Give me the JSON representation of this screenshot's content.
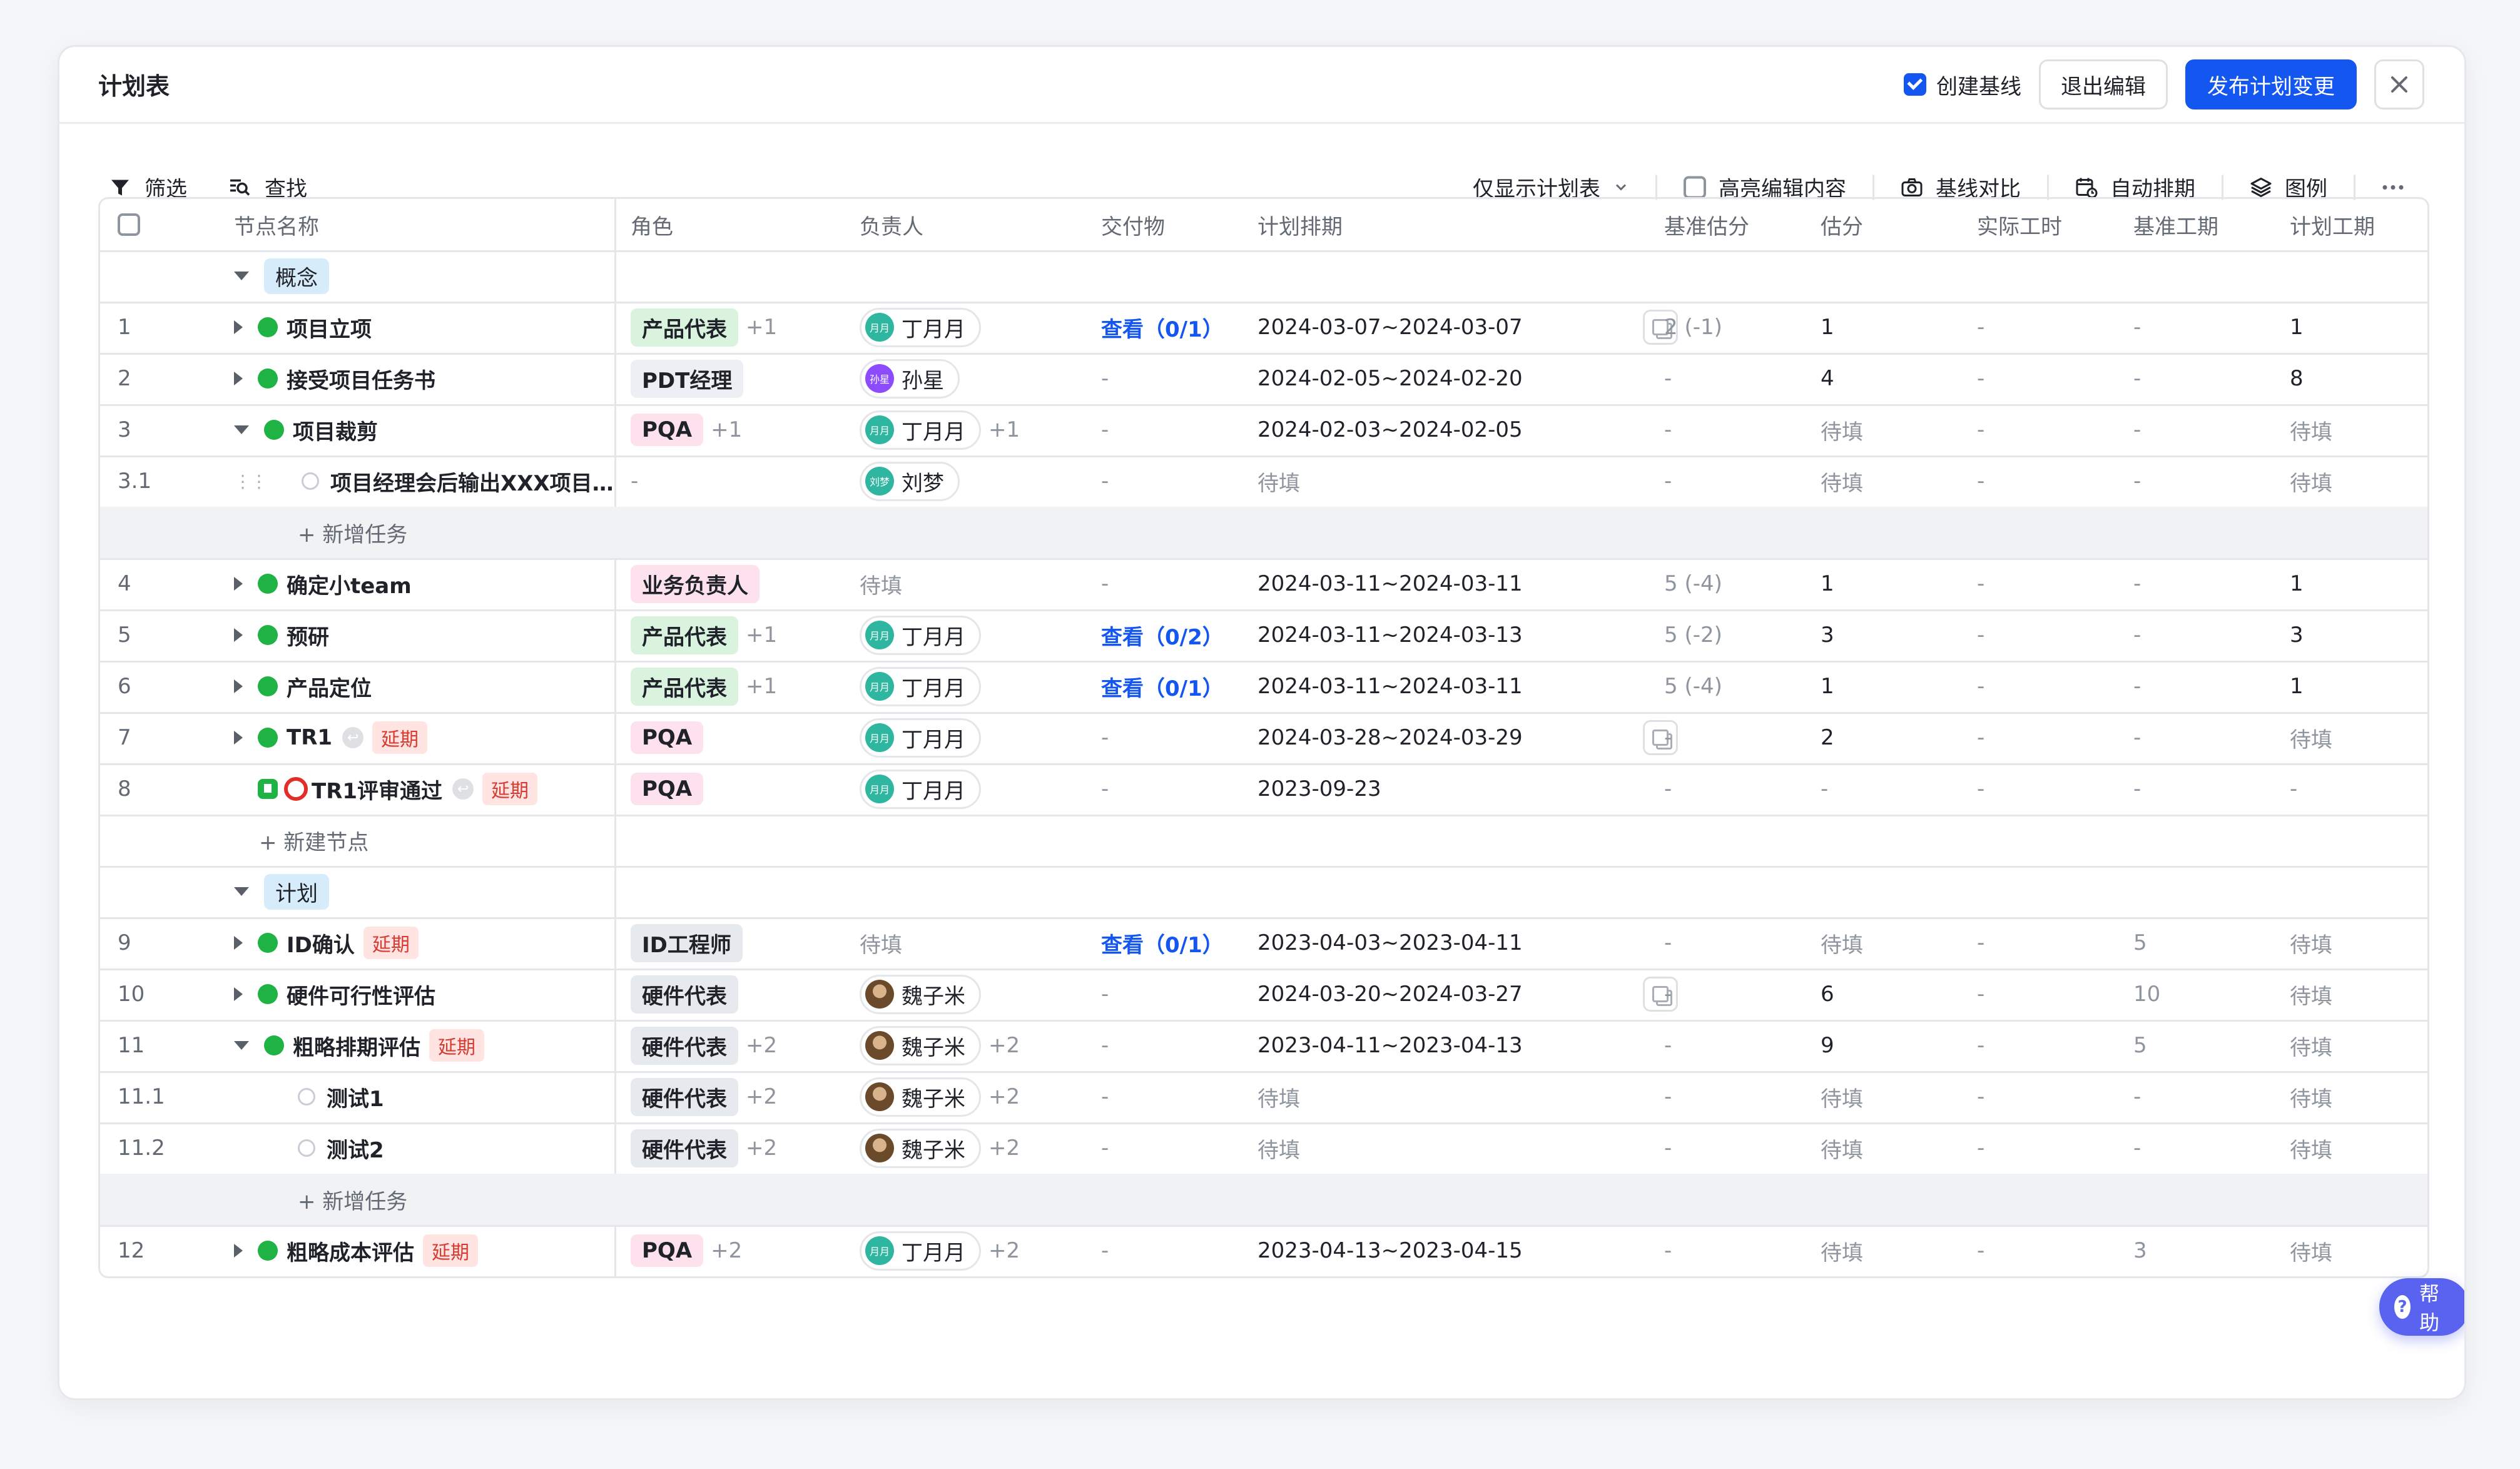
{
  "header": {
    "title": "计划表",
    "create_baseline_label": "创建基线",
    "create_baseline_checked": true,
    "exit_edit_label": "退出编辑",
    "publish_label": "发布计划变更",
    "close_icon": "close-icon"
  },
  "toolbar": {
    "filter_label": "筛选",
    "search_label": "查找",
    "view_select_value": "仅显示计划表",
    "highlight_label": "高亮编辑内容",
    "compare_label": "基线对比",
    "auto_schedule_label": "自动排期",
    "legend_label": "图例",
    "more_icon": "more-icon"
  },
  "columns": [
    "节点名称",
    "角色",
    "负责人",
    "交付物",
    "计划排期",
    "基准估分",
    "估分",
    "实际工时",
    "基准工期",
    "计划工期"
  ],
  "groups": {
    "concept": "概念",
    "plan": "计划"
  },
  "rows": [
    {
      "num": "1",
      "name": "项目立项",
      "role": "产品代表",
      "role_extra": "+1",
      "owner": "丁月月",
      "owner_avatar": "月月",
      "owner_extra": "",
      "deliverable": "查看（0/1）",
      "schedule": "2024-03-07~2024-03-07",
      "base_score": "2 (-1)",
      "score": "1",
      "actual": "-",
      "base_dur": "-",
      "plan_dur": "1"
    },
    {
      "num": "2",
      "name": "接受项目任务书",
      "role": "PDT经理",
      "role_extra": "",
      "owner": "孙星",
      "owner_avatar": "孙星",
      "owner_extra": "",
      "deliverable": "-",
      "schedule": "2024-02-05~2024-02-20",
      "base_score": "-",
      "score": "4",
      "actual": "-",
      "base_dur": "-",
      "plan_dur": "8"
    },
    {
      "num": "3",
      "name": "项目裁剪",
      "role": "PQA",
      "role_extra": "+1",
      "owner": "丁月月",
      "owner_avatar": "月月",
      "owner_extra": "+1",
      "deliverable": "-",
      "schedule": "2024-02-03~2024-02-05",
      "base_score": "-",
      "score": "待填",
      "actual": "-",
      "base_dur": "-",
      "plan_dur": "待填"
    },
    {
      "num": "3.1",
      "name": "项目经理会后输出XXX项目…",
      "role": "-",
      "role_extra": "",
      "owner": "刘梦",
      "owner_avatar": "刘梦",
      "owner_extra": "",
      "deliverable": "-",
      "schedule": "待填",
      "base_score": "-",
      "score": "待填",
      "actual": "-",
      "base_dur": "-",
      "plan_dur": "待填"
    },
    {
      "add_task": "+ 新增任务"
    },
    {
      "num": "4",
      "name": "确定小team",
      "role": "业务负责人",
      "role_extra": "",
      "owner": "待填",
      "owner_avatar": "",
      "owner_extra": "",
      "deliverable": "-",
      "schedule": "2024-03-11~2024-03-11",
      "base_score": "5 (-4)",
      "score": "1",
      "actual": "-",
      "base_dur": "-",
      "plan_dur": "1"
    },
    {
      "num": "5",
      "name": "预研",
      "role": "产品代表",
      "role_extra": "+1",
      "owner": "丁月月",
      "owner_avatar": "月月",
      "owner_extra": "",
      "deliverable": "查看（0/2）",
      "schedule": "2024-03-11~2024-03-13",
      "base_score": "5 (-2)",
      "score": "3",
      "actual": "-",
      "base_dur": "-",
      "plan_dur": "3"
    },
    {
      "num": "6",
      "name": "产品定位",
      "role": "产品代表",
      "role_extra": "+1",
      "owner": "丁月月",
      "owner_avatar": "月月",
      "owner_extra": "",
      "deliverable": "查看（0/1）",
      "schedule": "2024-03-11~2024-03-11",
      "base_score": "5 (-4)",
      "score": "1",
      "actual": "-",
      "base_dur": "-",
      "plan_dur": "1"
    },
    {
      "num": "7",
      "name": "TR1",
      "tag": "延期",
      "role": "PQA",
      "role_extra": "",
      "owner": "丁月月",
      "owner_avatar": "月月",
      "owner_extra": "",
      "deliverable": "-",
      "schedule": "2024-03-28~2024-03-29",
      "base_score": "-",
      "score": "2",
      "actual": "-",
      "base_dur": "-",
      "plan_dur": "待填"
    },
    {
      "num": "8",
      "name": "TR1评审通过",
      "tag": "延期",
      "role": "PQA",
      "role_extra": "",
      "owner": "丁月月",
      "owner_avatar": "月月",
      "owner_extra": "",
      "deliverable": "-",
      "schedule": "2023-09-23",
      "base_score": "-",
      "score": "-",
      "actual": "-",
      "base_dur": "-",
      "plan_dur": "-"
    },
    {
      "add_node": "+ 新建节点"
    },
    {
      "num": "9",
      "name": "ID确认",
      "tag": "延期",
      "role": "ID工程师",
      "role_extra": "",
      "owner": "待填",
      "owner_avatar": "",
      "owner_extra": "",
      "deliverable": "查看（0/1）",
      "schedule": "2023-04-03~2023-04-11",
      "base_score": "-",
      "score": "待填",
      "actual": "-",
      "base_dur": "5",
      "plan_dur": "待填"
    },
    {
      "num": "10",
      "name": "硬件可行性评估",
      "role": "硬件代表",
      "role_extra": "",
      "owner": "魏子米",
      "owner_avatar": "",
      "owner_extra": "",
      "deliverable": "-",
      "schedule": "2024-03-20~2024-03-27",
      "base_score": "-",
      "score": "6",
      "actual": "-",
      "base_dur": "10",
      "plan_dur": "待填"
    },
    {
      "num": "11",
      "name": "粗略排期评估",
      "tag": "延期",
      "role": "硬件代表",
      "role_extra": "+2",
      "owner": "魏子米",
      "owner_avatar": "",
      "owner_extra": "+2",
      "deliverable": "-",
      "schedule": "2023-04-11~2023-04-13",
      "base_score": "-",
      "score": "9",
      "actual": "-",
      "base_dur": "5",
      "plan_dur": "待填"
    },
    {
      "num": "11.1",
      "name": "测试1",
      "role": "硬件代表",
      "role_extra": "+2",
      "owner": "魏子米",
      "owner_avatar": "",
      "owner_extra": "+2",
      "deliverable": "-",
      "schedule": "待填",
      "base_score": "-",
      "score": "待填",
      "actual": "-",
      "base_dur": "-",
      "plan_dur": "待填"
    },
    {
      "num": "11.2",
      "name": "测试2",
      "role": "硬件代表",
      "role_extra": "+2",
      "owner": "魏子米",
      "owner_avatar": "",
      "owner_extra": "+2",
      "deliverable": "-",
      "schedule": "待填",
      "base_score": "-",
      "score": "待填",
      "actual": "-",
      "base_dur": "-",
      "plan_dur": "待填"
    },
    {
      "add_task": "+ 新增任务"
    },
    {
      "num": "12",
      "name": "粗略成本评估",
      "tag": "延期",
      "role": "PQA",
      "role_extra": "+2",
      "owner": "丁月月",
      "owner_avatar": "月月",
      "owner_extra": "+2",
      "deliverable": "-",
      "schedule": "2023-04-13~2023-04-15",
      "base_score": "-",
      "score": "待填",
      "actual": "-",
      "base_dur": "3",
      "plan_dur": "待填"
    }
  ],
  "role_colors": {
    "产品代表": "#d9f3df",
    "PDT经理": "#eceff3",
    "PQA": "#fde2ee",
    "业务负责人": "#fde2ee",
    "ID工程师": "#e6e9ee",
    "硬件代表": "#e6e9ee"
  },
  "help_label": "帮助"
}
